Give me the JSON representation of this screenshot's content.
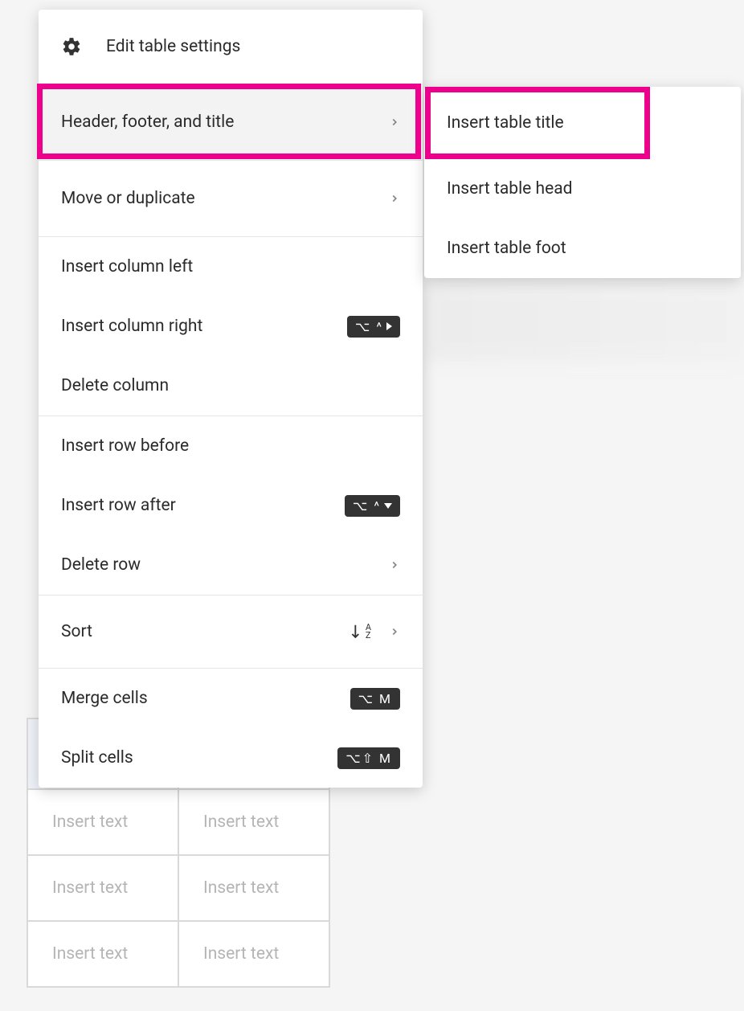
{
  "main_menu": {
    "settings": "Edit table settings",
    "header_footer_title": "Header, footer, and title",
    "move_duplicate": "Move or duplicate",
    "insert_col_left": "Insert column left",
    "insert_col_right": "Insert column right",
    "delete_col": "Delete column",
    "insert_row_before": "Insert row before",
    "insert_row_after": "Insert row after",
    "delete_row": "Delete row",
    "sort": "Sort",
    "merge": "Merge cells",
    "split": "Split cells",
    "kbd_col_right": "⌥ ^",
    "kbd_row_after": "⌥ ^",
    "kbd_merge": "⌥  M",
    "kbd_split": "⌥⇧ M"
  },
  "submenu": {
    "insert_title": "Insert table title",
    "insert_head": "Insert table head",
    "insert_foot": "Insert table foot"
  },
  "table": {
    "placeholder": "Insert text"
  }
}
